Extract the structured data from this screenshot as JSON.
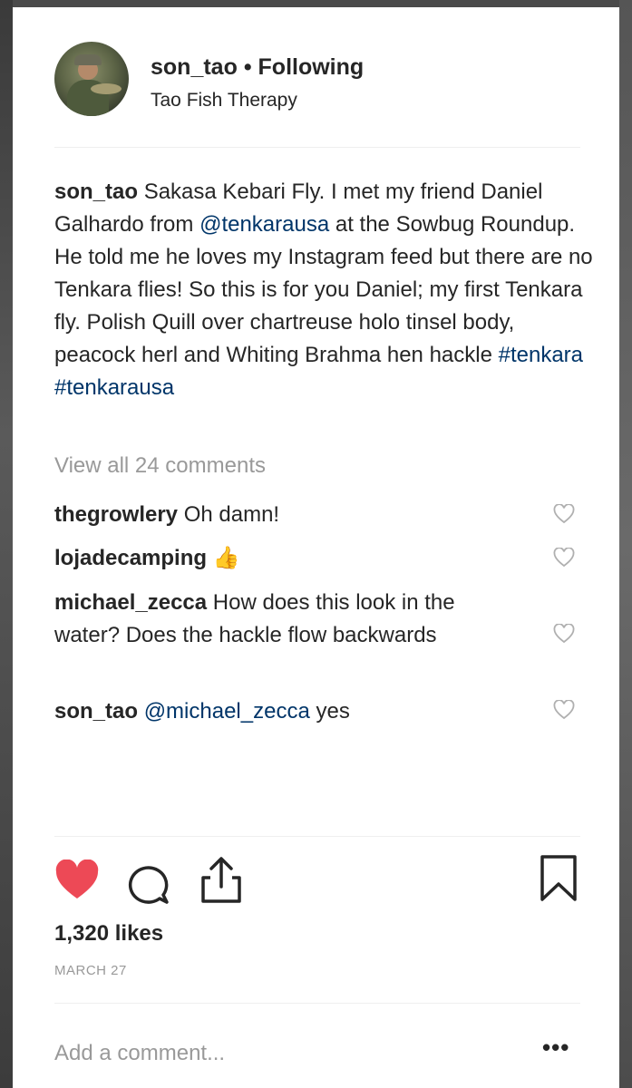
{
  "post": {
    "author": {
      "username": "son_tao",
      "separator": "•",
      "follow_status": "Following",
      "subtitle": "Tao Fish Therapy"
    },
    "caption": {
      "username": "son_tao",
      "text_1": "Sakasa Kebari Fly. I met my friend Daniel Galhardo from ",
      "mention": "@tenkarausa",
      "text_2": " at the Sowbug Roundup. He told me he loves my Instagram feed but there are no Tenkara flies! So this is for you Daniel; my first Tenkara fly. Polish Quill over chartreuse holo tinsel body, peacock herl and Whiting Brahma hen hackle ",
      "hashtag_1": "#tenkara",
      "hashtag_2": "#tenkarausa"
    },
    "view_all_comments": "View all 24 comments",
    "comments": [
      {
        "username": "thegrowlery",
        "text": "Oh damn!"
      },
      {
        "username": "lojadecamping",
        "text": "👍"
      },
      {
        "username": "michael_zecca",
        "text": "How does this look in the water? Does the hackle flow backwards"
      },
      {
        "username": "son_tao",
        "mention": "@michael_zecca",
        "text": "yes"
      }
    ],
    "likes": "1,320 likes",
    "date": "MARCH 27",
    "add_comment_placeholder": "Add a comment...",
    "more_label": "•••",
    "liked": true,
    "colors": {
      "like_red": "#ed4956",
      "link_blue": "#003569",
      "muted_gray": "#999999",
      "text_dark": "#262626"
    }
  }
}
